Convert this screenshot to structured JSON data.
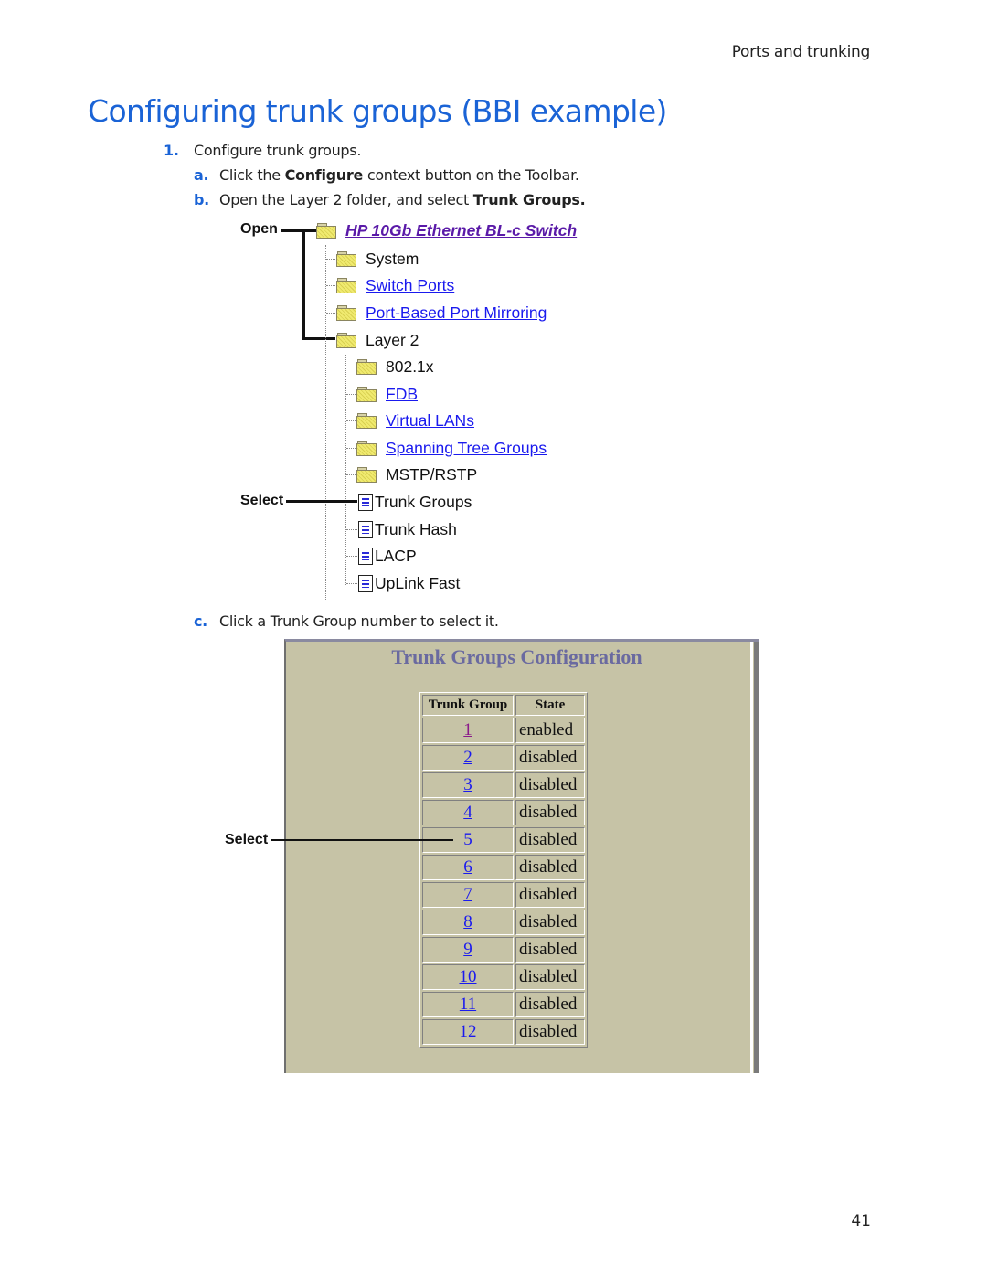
{
  "header": {
    "section": "Ports and trunking"
  },
  "title": "Configuring trunk groups (BBI example)",
  "steps": {
    "step1": {
      "num": "1.",
      "text": "Configure trunk groups."
    },
    "a": {
      "num": "a.",
      "pre": "Click the ",
      "bold": "Configure",
      "post": " context button on the Toolbar."
    },
    "b": {
      "num": "b.",
      "pre": "Open the Layer 2 folder, and select ",
      "bold": "Trunk Groups."
    },
    "c": {
      "num": "c.",
      "text": "Click a Trunk Group number to select it."
    }
  },
  "tree": {
    "callout_open": "Open",
    "callout_select": "Select",
    "root": "HP 10Gb Ethernet BL-c Switch",
    "items": [
      {
        "label": "System",
        "link": false,
        "icon": "folder-icon"
      },
      {
        "label": "Switch Ports",
        "link": true,
        "icon": "folder-icon"
      },
      {
        "label": "Port-Based Port Mirroring",
        "link": true,
        "icon": "folder-icon"
      },
      {
        "label": "Layer 2",
        "link": false,
        "icon": "open-folder-icon"
      }
    ],
    "layer2_items": [
      {
        "label": "802.1x",
        "link": false,
        "icon": "folder-icon"
      },
      {
        "label": "FDB",
        "link": true,
        "icon": "folder-icon"
      },
      {
        "label": "Virtual LANs",
        "link": true,
        "icon": "folder-icon"
      },
      {
        "label": "Spanning Tree Groups",
        "link": true,
        "icon": "folder-icon"
      },
      {
        "label": "MSTP/RSTP",
        "link": false,
        "icon": "folder-icon"
      },
      {
        "label": "Trunk Groups",
        "link": false,
        "icon": "document-icon"
      },
      {
        "label": "Trunk Hash",
        "link": false,
        "icon": "document-icon"
      },
      {
        "label": "LACP",
        "link": false,
        "icon": "document-icon"
      },
      {
        "label": "UpLink Fast",
        "link": false,
        "icon": "document-icon"
      }
    ]
  },
  "panel": {
    "title": "Trunk Groups Configuration",
    "callout_select": "Select",
    "columns": [
      "Trunk Group",
      "State"
    ],
    "rows": [
      {
        "group": "1",
        "state": "enabled",
        "visited": true
      },
      {
        "group": "2",
        "state": "disabled"
      },
      {
        "group": "3",
        "state": "disabled"
      },
      {
        "group": "4",
        "state": "disabled"
      },
      {
        "group": "5",
        "state": "disabled"
      },
      {
        "group": "6",
        "state": "disabled"
      },
      {
        "group": "7",
        "state": "disabled"
      },
      {
        "group": "8",
        "state": "disabled"
      },
      {
        "group": "9",
        "state": "disabled"
      },
      {
        "group": "10",
        "state": "disabled"
      },
      {
        "group": "11",
        "state": "disabled"
      },
      {
        "group": "12",
        "state": "disabled"
      }
    ]
  },
  "footer": {
    "page_number": "41"
  },
  "colors": {
    "heading": "#1a63d6",
    "link": "#1a1aee",
    "visited_link": "#8a1a8a",
    "panel_bg": "#c6c3a6",
    "panel_title": "#6a6aa0"
  }
}
